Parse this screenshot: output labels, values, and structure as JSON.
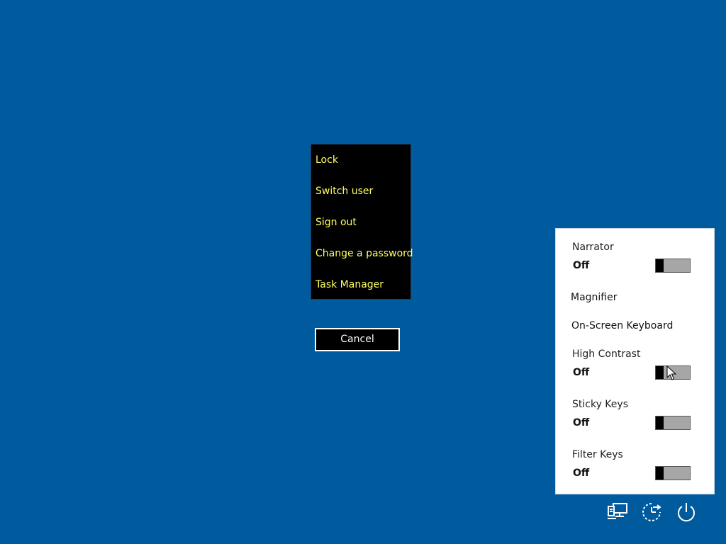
{
  "colors": {
    "background": "#005a9e",
    "menu_text": "#ffff5f",
    "button_text": "#ffffff",
    "panel_bg": "#ffffff"
  },
  "menu": {
    "items": [
      {
        "label": "Lock"
      },
      {
        "label": "Switch user"
      },
      {
        "label": "Sign out"
      },
      {
        "label": "Change a password"
      },
      {
        "label": "Task Manager"
      }
    ]
  },
  "cancel": {
    "label": "Cancel"
  },
  "ease": {
    "narrator": {
      "label": "Narrator",
      "state": "Off"
    },
    "magnifier": {
      "label": "Magnifier"
    },
    "keyboard": {
      "label": "On-Screen Keyboard"
    },
    "contrast": {
      "label": "High Contrast",
      "state": "Off"
    },
    "sticky": {
      "label": "Sticky Keys",
      "state": "Off"
    },
    "filter": {
      "label": "Filter Keys",
      "state": "Off"
    }
  },
  "tray": {
    "icons": [
      "network-icon",
      "ease-of-access-icon",
      "power-icon"
    ]
  }
}
